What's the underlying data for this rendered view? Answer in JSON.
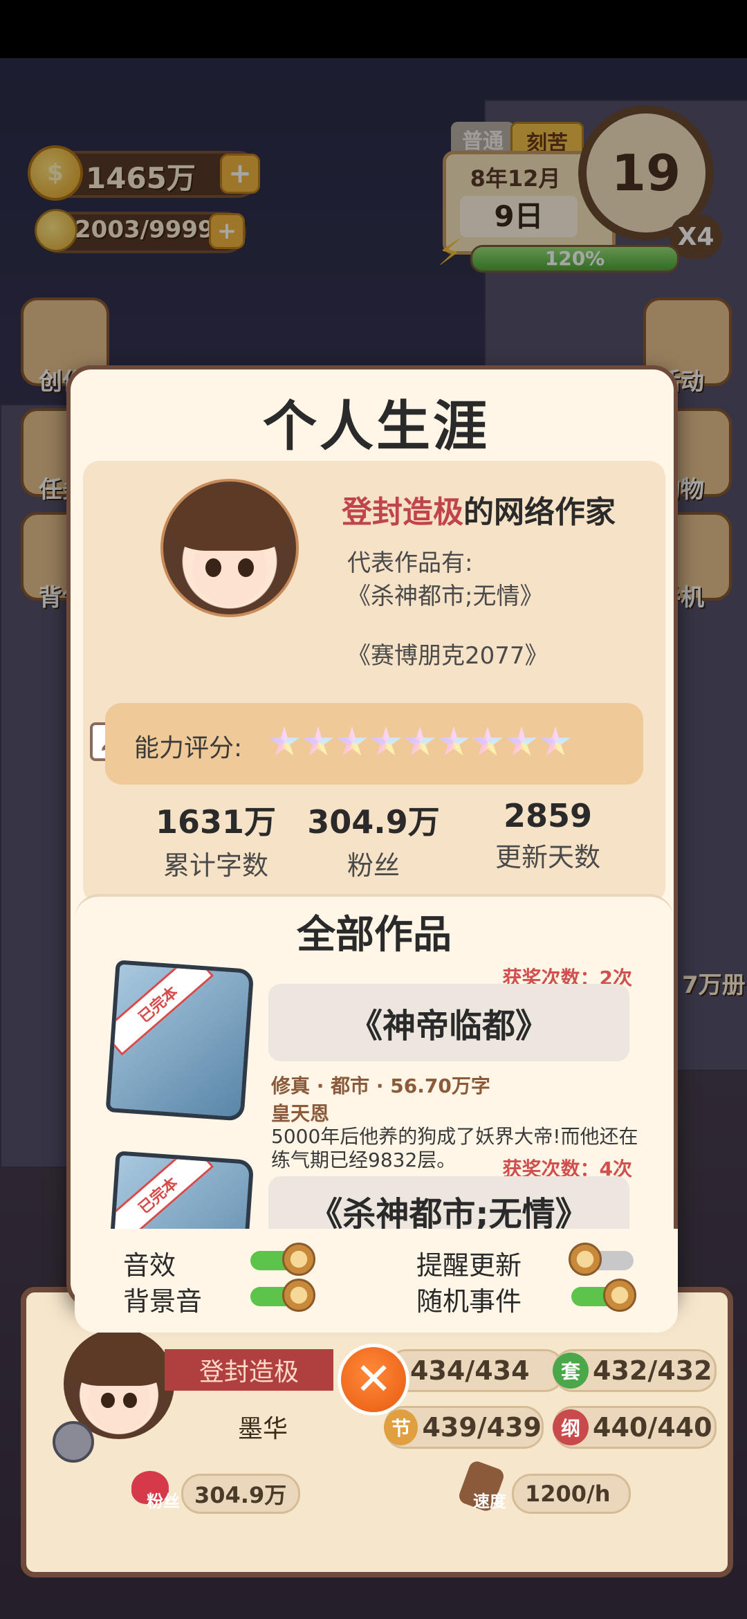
{
  "hud": {
    "coins": "1465万",
    "inspiration": "2003/9999",
    "mode_normal": "普通",
    "mode_hard": "刻苦",
    "date_month": "8年12月",
    "date_day": "9日",
    "clock_value": "19",
    "speed_multiplier": "X4",
    "energy_percent": "120%",
    "energy_fill": 1.0,
    "side_left": [
      "创作",
      "任务",
      "背包"
    ],
    "side_right": [
      "活动",
      "购物",
      "手机"
    ]
  },
  "modal": {
    "title": "个人生涯",
    "headline_highlight": "登封造极",
    "headline_rest": "的网络作家",
    "works_intro": "代表作品有:",
    "rep_work_1": "《杀神都市;无情》",
    "rep_work_2": "《赛博朋克2077》",
    "author_name": "墨华",
    "rating_label": "能力评分:",
    "rating_stars": 9,
    "stats": [
      {
        "value": "1631万",
        "label": "累计字数"
      },
      {
        "value": "304.9万",
        "label": "粉丝"
      },
      {
        "value": "2859",
        "label": "更新天数"
      }
    ],
    "works_title": "全部作品",
    "works": [
      {
        "title": "《神帝临都》",
        "award": "获奖次数：2次",
        "ribbon": "已完本",
        "meta": "修真 · 都市 · 56.70万字",
        "hero": "皇天恩",
        "desc": "5000年后他养的狗成了妖界大帝!而他还在练气期已经9832层。"
      },
      {
        "title": "《杀神都市;无情》",
        "award": "获奖次数：4次",
        "ribbon": "已完本"
      }
    ],
    "settings": [
      {
        "label": "音效",
        "on": true
      },
      {
        "label": "提醒更新",
        "on": false
      },
      {
        "label": "背景音",
        "on": true
      },
      {
        "label": "随机事件",
        "on": true
      }
    ]
  },
  "side_partial_text": "7万册",
  "bottom": {
    "title_ribbon": "登封造极",
    "name": "墨华",
    "stat1": "434/434",
    "stat2": "432/432",
    "stat3_badge": "节",
    "stat3": "439/439",
    "stat4_badge": "纲",
    "stat4": "440/440",
    "stat2_badge": "套",
    "fans_label": "粉丝",
    "fans": "304.9万",
    "speed_label": "速度",
    "speed": "1200/h"
  },
  "colors": {
    "highlight_red": "#c0444a",
    "award_red": "#d05050",
    "toggle_on": "#5cc44a",
    "toggle_off": "#c8c8c8",
    "modal_border": "#6e4a3a"
  }
}
